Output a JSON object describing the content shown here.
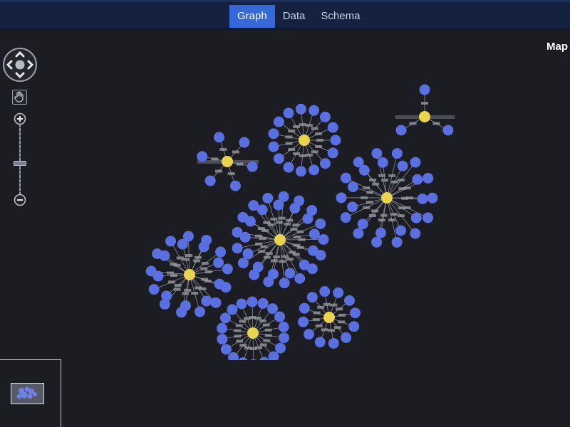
{
  "header": {
    "tabs": [
      {
        "label": "Graph",
        "active": true
      },
      {
        "label": "Data",
        "active": false
      },
      {
        "label": "Schema",
        "active": false
      }
    ]
  },
  "map": {
    "label": "Map"
  },
  "controls": {
    "icons": [
      "pan-arrows-icon",
      "hand-icon",
      "zoom-in-icon",
      "zoom-out-icon"
    ]
  },
  "graph": {
    "colors": {
      "hub": "#e8d44d",
      "leaf": "#5a6fe0",
      "edge": "#8a8d96"
    },
    "clusters": [
      {
        "leaves": 15
      },
      {
        "leaves": 6
      },
      {
        "leaves": 3
      },
      {
        "leaves": 25
      },
      {
        "leaves": 30
      },
      {
        "leaves": 22
      },
      {
        "leaves": 18
      },
      {
        "leaves": 12
      }
    ]
  }
}
